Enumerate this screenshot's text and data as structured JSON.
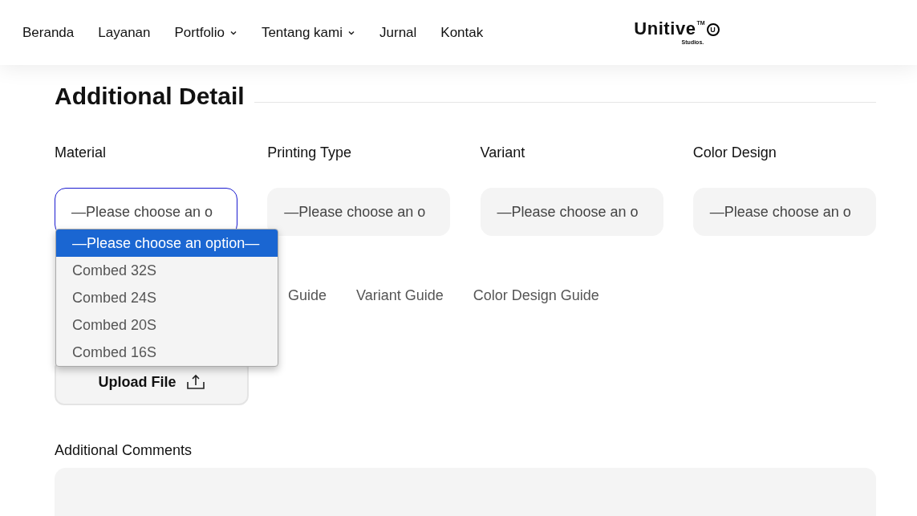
{
  "nav": {
    "items": [
      {
        "label": "Beranda",
        "has_menu": false
      },
      {
        "label": "Layanan",
        "has_menu": false
      },
      {
        "label": "Portfolio",
        "has_menu": true
      },
      {
        "label": "Tentang kami",
        "has_menu": true
      },
      {
        "label": "Jurnal",
        "has_menu": false
      },
      {
        "label": "Kontak",
        "has_menu": false
      }
    ],
    "logo": {
      "name": "Unitive",
      "tm": "TM",
      "mark": "U",
      "sub": "Studios."
    }
  },
  "section": {
    "title": "Additional Detail",
    "fields": [
      {
        "label": "Material",
        "value": "—Please choose an o",
        "focused": true
      },
      {
        "label": "Printing Type",
        "value": "—Please choose an o",
        "focused": false
      },
      {
        "label": "Variant",
        "value": "—Please choose an o",
        "focused": false
      },
      {
        "label": "Color Design",
        "value": "—Please choose an o",
        "focused": false
      }
    ],
    "dropdown": {
      "options": [
        {
          "label": "—Please choose an option—",
          "selected": true
        },
        {
          "label": "Combed 32S",
          "selected": false
        },
        {
          "label": "Combed 24S",
          "selected": false
        },
        {
          "label": "Combed 20S",
          "selected": false
        },
        {
          "label": "Combed 16S",
          "selected": false
        }
      ]
    },
    "guides": [
      "Guide",
      "Variant Guide",
      "Color Design Guide"
    ],
    "upload": {
      "label": "Upload File"
    },
    "comments": {
      "label": "Additional Comments"
    }
  }
}
